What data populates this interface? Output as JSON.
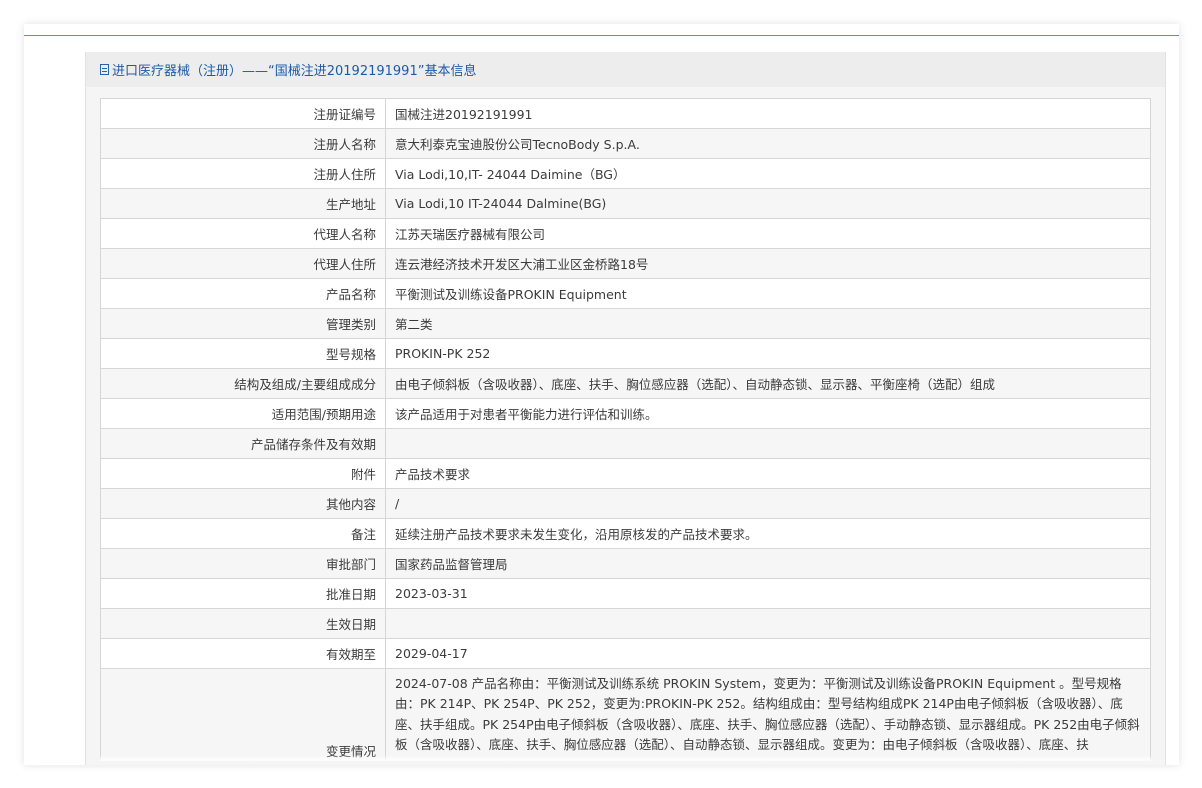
{
  "panel": {
    "title": "进口医疗器械（注册）——“国械注进20192191991”基本信息",
    "icon": "document-icon"
  },
  "rows": [
    {
      "label": "注册证编号",
      "value": "国械注进20192191991"
    },
    {
      "label": "注册人名称",
      "value": "意大利泰克宝迪股份公司TecnoBody S.p.A."
    },
    {
      "label": "注册人住所",
      "value": "Via Lodi,10,IT- 24044 Daimine（BG）"
    },
    {
      "label": "生产地址",
      "value": "Via Lodi,10 IT-24044 Dalmine(BG)"
    },
    {
      "label": "代理人名称",
      "value": "江苏天瑞医疗器械有限公司"
    },
    {
      "label": "代理人住所",
      "value": "连云港经济技术开发区大浦工业区金桥路18号"
    },
    {
      "label": "产品名称",
      "value": "平衡测试及训练设备PROKIN Equipment"
    },
    {
      "label": "管理类别",
      "value": "第二类"
    },
    {
      "label": "型号规格",
      "value": "PROKIN-PK 252"
    },
    {
      "label": "结构及组成/主要组成成分",
      "value": "由电子倾斜板（含吸收器）、底座、扶手、胸位感应器（选配）、自动静态锁、显示器、平衡座椅（选配）组成"
    },
    {
      "label": "适用范围/预期用途",
      "value": "该产品适用于对患者平衡能力进行评估和训练。"
    },
    {
      "label": "产品储存条件及有效期",
      "value": ""
    },
    {
      "label": "附件",
      "value": "产品技术要求"
    },
    {
      "label": "其他内容",
      "value": "/"
    },
    {
      "label": "备注",
      "value": "延续注册产品技术要求未发生变化，沿用原核发的产品技术要求。"
    },
    {
      "label": "审批部门",
      "value": "国家药品监督管理局"
    },
    {
      "label": "批准日期",
      "value": "2023-03-31"
    },
    {
      "label": "生效日期",
      "value": ""
    },
    {
      "label": "有效期至",
      "value": "2029-04-17"
    }
  ],
  "change_row": {
    "label": "变更情况",
    "value": "2024-07-08 产品名称由：平衡测试及训练系统 PROKIN System，变更为：平衡测试及训练设备PROKIN Equipment 。型号规格由：PK 214P、PK 254P、PK 252，变更为:PROKIN-PK 252。结构组成由：型号结构组成PK 214P由电子倾斜板（含吸收器）、底座、扶手组成。PK 254P由电子倾斜板（含吸收器）、底座、扶手、胸位感应器（选配）、手动静态锁、显示器组成。PK 252由电子倾斜板（含吸收器）、底座、扶手、胸位感应器（选配）、自动静态锁、显示器组成。变更为：由电子倾斜板（含吸收器）、底座、扶"
  }
}
